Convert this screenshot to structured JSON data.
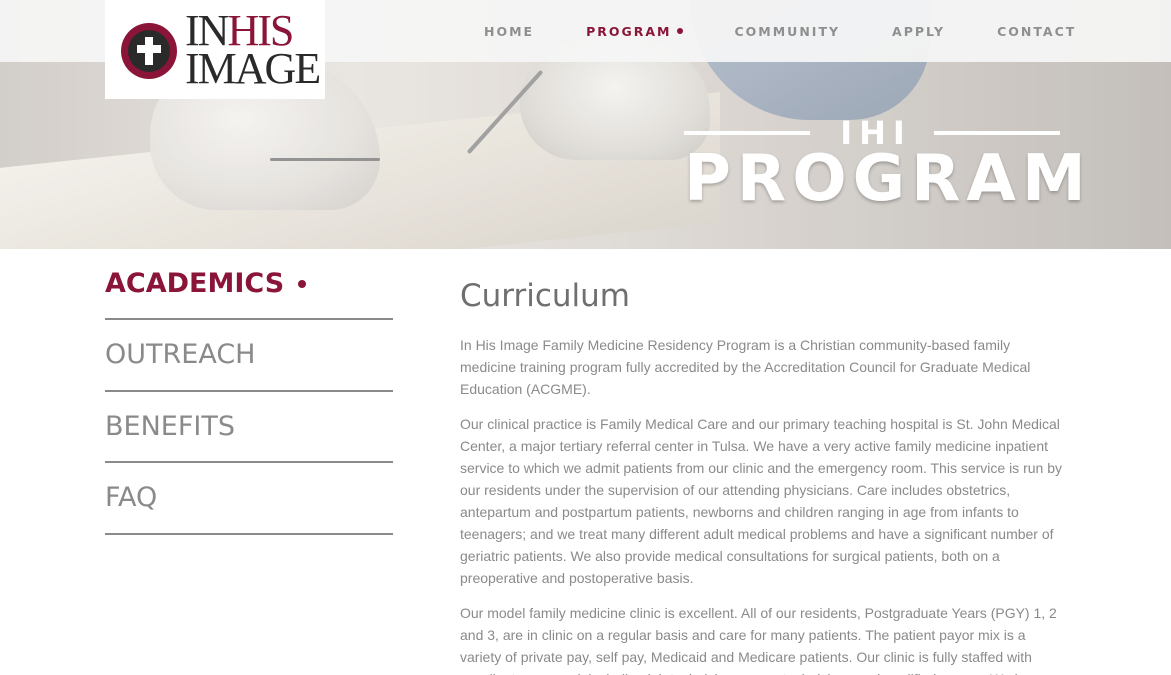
{
  "brand": {
    "logo_line1_a": "IN",
    "logo_line1_b": "HIS",
    "logo_line2": "IMAGE",
    "accent_color": "#8a1538"
  },
  "nav": {
    "items": [
      {
        "label": "HOME"
      },
      {
        "label": "PROGRAM"
      },
      {
        "label": "COMMUNITY"
      },
      {
        "label": "APPLY"
      },
      {
        "label": "CONTACT"
      }
    ],
    "active": "PROGRAM"
  },
  "hero": {
    "small": "IHI",
    "big": "PROGRAM"
  },
  "sidebar": {
    "items": [
      {
        "label": "ACADEMICS"
      },
      {
        "label": "OUTREACH"
      },
      {
        "label": "BENEFITS"
      },
      {
        "label": "FAQ"
      }
    ],
    "active": "ACADEMICS"
  },
  "main": {
    "title": "Curriculum",
    "paragraphs": [
      "In His Image Family Medicine Residency Program is a Christian community-based family medicine training program fully accredited by the Accreditation Council for Graduate Medical Education (ACGME).",
      "Our clinical practice is Family Medical Care and our primary teaching hospital is St. John Medical Center, a major tertiary referral center in Tulsa. We have a very active family medicine inpatient service to which we admit patients from our clinic and the emergency room. This service is run by our residents under the supervision of our attending physicians. Care includes obstetrics, antepartum and postpartum patients, newborns and children ranging in age from infants to teenagers; and we treat many different adult medical problems and have a significant number of geriatric patients. We also provide medical consultations for surgical patients, both on a preoperative and postoperative basis.",
      "Our model family medicine clinic is excellent. All of our residents, Postgraduate Years (PGY) 1, 2 and 3, are in clinic on a regular basis and care for many patients. The patient payor mix is a variety of private pay, self pay, Medicaid and Medicare patients. Our clinic is fully staffed with excellent personnel, including lab technicians, x-ray technicians and qualified nurses. We have x"
    ]
  }
}
